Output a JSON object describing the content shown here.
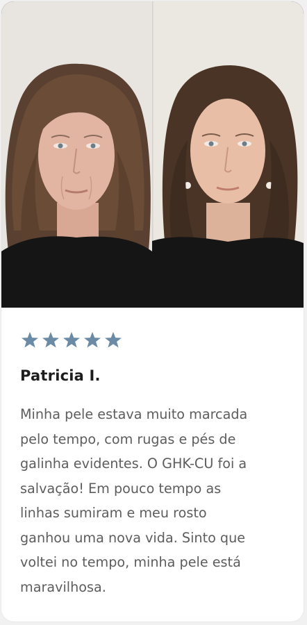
{
  "testimonial": {
    "rating": 5,
    "max_rating": 5,
    "star_color": "#6a8aa6",
    "name": "Patricia I.",
    "review_lines": [
      "Minha pele estava muito marcada",
      "pelo tempo, com rugas e pés de",
      "galinha evidentes. O GHK-CU foi a",
      "salvação! Em pouco tempo as",
      "linhas sumiram e meu rosto",
      "ganhou uma nova vida. Sinto que",
      "voltei no tempo, minha pele está",
      "maravilhosa."
    ],
    "photo_left": "before-photo",
    "photo_right": "after-photo"
  }
}
